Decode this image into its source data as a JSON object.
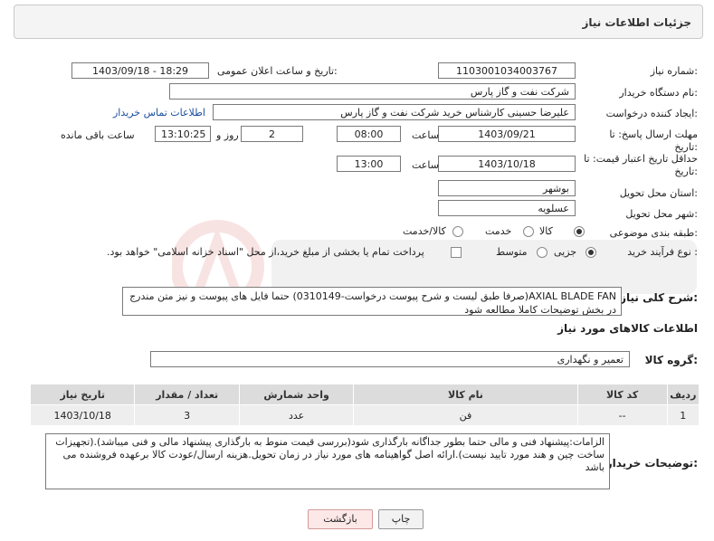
{
  "header": {
    "title": "جزئیات اطلاعات نیاز"
  },
  "fields": {
    "need_number_label": "شماره نیاز:",
    "need_number": "1103001034003767",
    "announce_label": "تاریخ و ساعت اعلان عمومی:",
    "announce_value": "1403/09/18 - 18:29",
    "buyer_label": "نام دستگاه خریدار:",
    "buyer_value": "شرکت نفت و گاز پارس",
    "creator_label": "ایجاد کننده درخواست:",
    "creator_value": "علیرضا حسینی کارشناس خرید شرکت نفت و گاز پارس",
    "contact_link": "اطلاعات تماس خریدار",
    "deadline_label": "مهلت ارسال پاسخ: تا",
    "date_suffix": "تاریخ:",
    "deadline_date": "1403/09/21",
    "hour_label": "ساعت",
    "deadline_time": "08:00",
    "days_value": "2",
    "days_label": "روز و",
    "remaining_time": "13:10:25",
    "remaining_label": "ساعت باقی مانده",
    "validity_label": "حداقل تاریخ اعتبار قیمت: تا",
    "validity_date": "1403/10/18",
    "validity_time": "13:00",
    "province_label": "استان محل تحویل:",
    "province_value": "بوشهر",
    "city_label": "شهر محل تحویل:",
    "city_value": "عسلویه",
    "category_label": "طبقه بندی موضوعی:",
    "category_options": [
      "کالا",
      "خدمت",
      "کالا/خدمت"
    ],
    "process_label": "نوع فرآیند خرید :",
    "process_options": [
      "جزیی",
      "متوسط"
    ],
    "payment_note": "پرداخت تمام یا بخشی از مبلغ خرید،از محل \"اسناد خزانه اسلامی\" خواهد بود."
  },
  "description": {
    "label": "شرح کلی نیاز:",
    "text": "AXIAL BLADE FAN(صرفا طبق لیست و شرح پیوست درخواست-0310149) حتما فایل های پیوست و نیز متن مندرج در بخش توضیحات کاملا مطالعه شود"
  },
  "goods": {
    "section_title": "اطلاعات کالاهای مورد نیاز",
    "group_label": "گروه کالا:",
    "group_value": "تعمیر و نگهداری",
    "columns": [
      "ردیف",
      "کد کالا",
      "نام کالا",
      "واحد شمارش",
      "تعداد / مقدار",
      "تاریخ نیاز"
    ],
    "rows": [
      {
        "row": "1",
        "code": "--",
        "name": "فن",
        "unit": "عدد",
        "qty": "3",
        "date": "1403/10/18"
      }
    ]
  },
  "notes": {
    "label": "توضیحات خریدار:",
    "text": "الزامات:پیشنهاد فنی و مالی حتما  بطور جداگانه بارگذاری شود(بررسی قیمت منوط به بارگذاری پیشنهاد مالی و فنی میباشد).(تجهیزات ساخت چین و هند مورد تایید نیست).ارائه اصل گواهینامه های مورد نیاز در زمان تحویل.هزینه ارسال/عودت کالا برعهده فروشنده می باشد"
  },
  "buttons": {
    "print": "چاپ",
    "back": "بازگشت"
  }
}
